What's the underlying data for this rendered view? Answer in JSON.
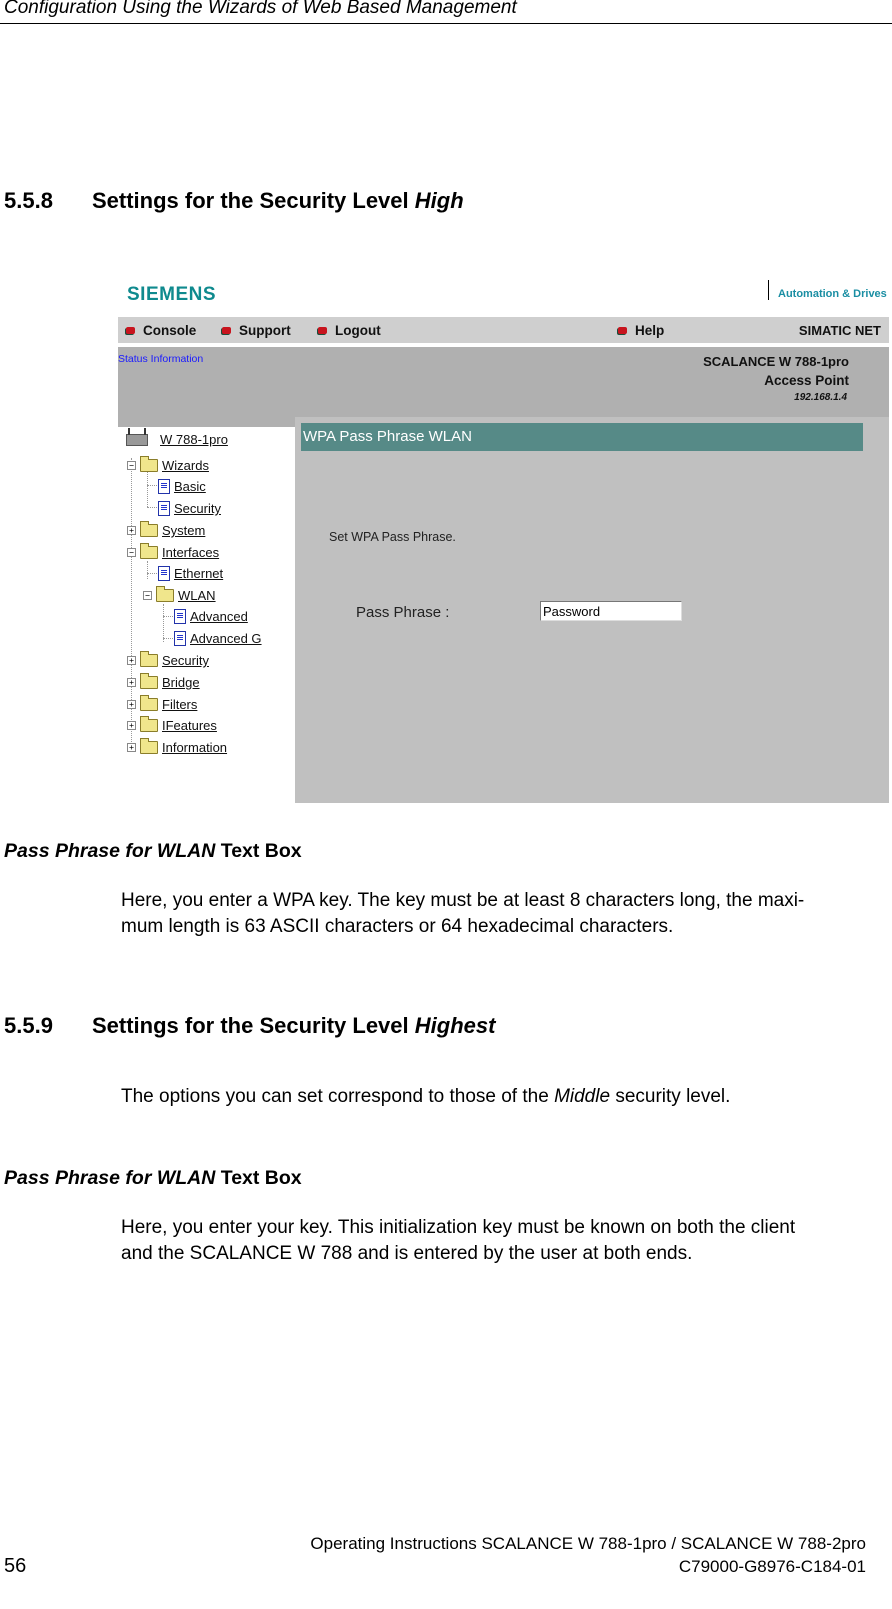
{
  "running_head": "Configuration Using the Wizards of Web Based Management",
  "section_558": {
    "number": "5.5.8",
    "title_prefix": "Settings for the Security Level ",
    "title_emph": "High"
  },
  "screenshot": {
    "logo": "SIEMENS",
    "brand": "Automation & Drives",
    "nav": [
      {
        "label": "Console",
        "icon": "red-bullet"
      },
      {
        "label": "Support",
        "icon": "red-bullet"
      },
      {
        "label": "Logout",
        "icon": "red-bullet"
      },
      {
        "label": "Help",
        "icon": "red-bullet"
      }
    ],
    "simatic": "SIMATIC NET",
    "status_link": "Status Information",
    "device": {
      "model": "SCALANCE W 788-1pro",
      "type": "Access Point",
      "ip": "192.168.1.4"
    },
    "tree": [
      {
        "label": "W 788-1pro",
        "kind": "router"
      },
      {
        "label": "Wizards",
        "kind": "folder-open",
        "toggle": "−"
      },
      {
        "label": "Basic",
        "kind": "doc"
      },
      {
        "label": "Security",
        "kind": "doc"
      },
      {
        "label": "System",
        "kind": "folder",
        "toggle": "+"
      },
      {
        "label": "Interfaces",
        "kind": "folder-open",
        "toggle": "−"
      },
      {
        "label": "Ethernet",
        "kind": "doc"
      },
      {
        "label": "WLAN",
        "kind": "folder-open",
        "toggle": "−"
      },
      {
        "label": "Advanced",
        "kind": "doc"
      },
      {
        "label": "Advanced G",
        "kind": "doc"
      },
      {
        "label": "Security",
        "kind": "folder",
        "toggle": "+"
      },
      {
        "label": "Bridge",
        "kind": "folder",
        "toggle": "+"
      },
      {
        "label": "Filters",
        "kind": "folder",
        "toggle": "+"
      },
      {
        "label": "IFeatures",
        "kind": "folder",
        "toggle": "+"
      },
      {
        "label": "Information",
        "kind": "folder",
        "toggle": "+"
      }
    ],
    "panel_title": "WPA Pass Phrase WLAN",
    "instruction": "Set WPA Pass Phrase.",
    "pass_phrase_label": "Pass Phrase :",
    "pass_phrase_value": "Password",
    "colors": {
      "title_bar": "#568a87",
      "logo": "#0f8a8e",
      "bullet": "#c8141e"
    }
  },
  "pass_phrase_high": {
    "heading_emph": "Pass Phrase for WLAN",
    "heading_rest": " Text Box",
    "lines": [
      "Here, you enter a WPA key. The key must be at least 8 characters long, the maxi-",
      "mum length is 63 ASCII characters or 64 hexadecimal characters."
    ]
  },
  "section_559": {
    "number": "5.5.9",
    "title_prefix": "Settings for the Security Level ",
    "title_emph": "Highest"
  },
  "highest_text": {
    "prefix": "The options you can set correspond to those of the ",
    "emph": "Middle",
    "suffix": " security level."
  },
  "pass_phrase_highest": {
    "heading_emph": "Pass Phrase for WLAN",
    "heading_rest": " Text Box",
    "lines": [
      "Here, you enter your key. This initialization key must be known on both the client",
      "and the SCALANCE W 788 and is entered by the user at both ends."
    ]
  },
  "footer": {
    "manual": "Operating Instructions SCALANCE W 788-1pro / SCALANCE W 788-2pro",
    "doc_id": "C79000-G8976-C184-01",
    "page": "56"
  }
}
